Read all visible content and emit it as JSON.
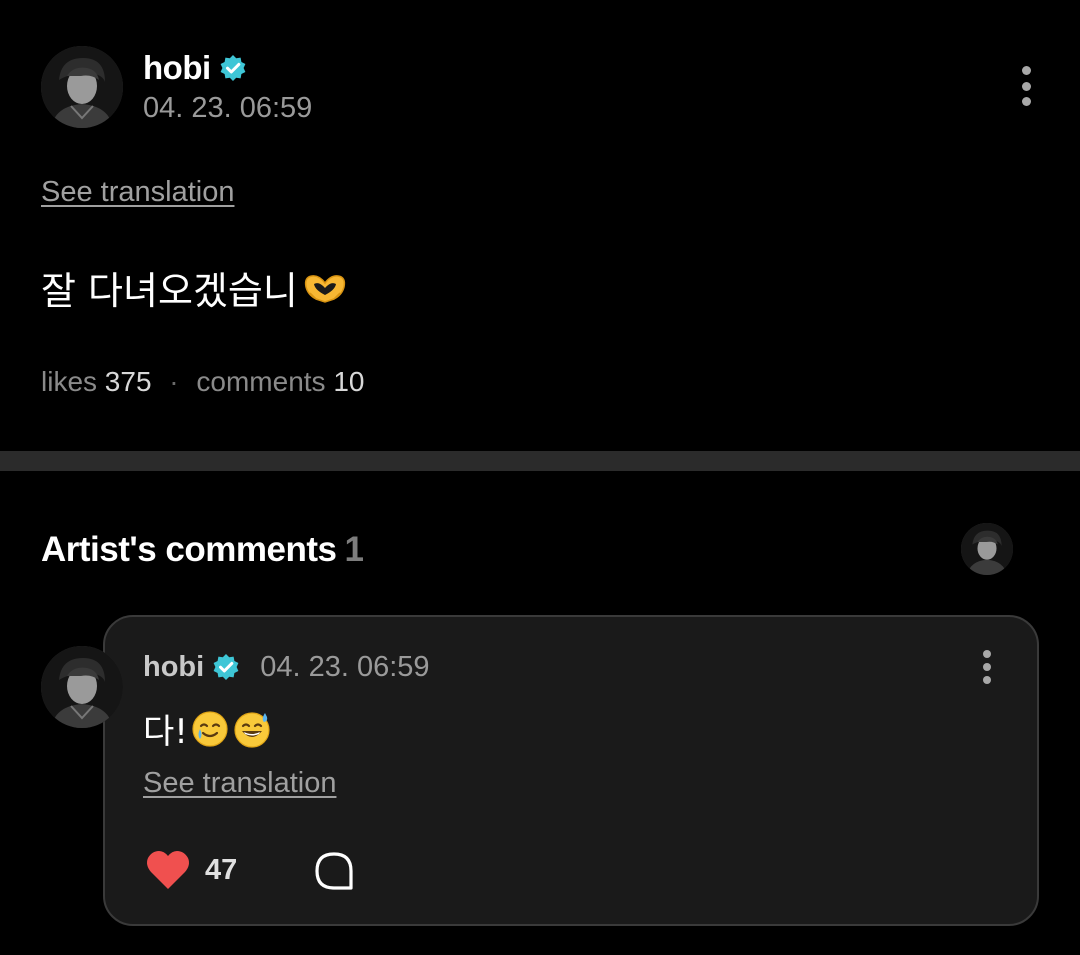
{
  "post": {
    "author": "hobi",
    "timestamp": "04. 23. 06:59",
    "see_translation": "See translation",
    "text": "잘 다녀오겠습니",
    "emoji_icon": "heart-hands-icon",
    "stats": {
      "likes_label": "likes",
      "likes_count": "375",
      "separator": "·",
      "comments_label": "comments",
      "comments_count": "10"
    }
  },
  "artist_comments": {
    "title": "Artist's comments",
    "count": "1"
  },
  "comment": {
    "author": "hobi",
    "timestamp": "04. 23. 06:59",
    "text": "다!",
    "emoji_icons": [
      "smiling-face-with-tear-icon",
      "grinning-face-with-sweat-icon"
    ],
    "see_translation": "See translation",
    "like_count": "47"
  },
  "colors": {
    "background": "#000000",
    "verified_badge": "#3ec6d6",
    "heart": "#f0504f",
    "card_background": "#1a1a1a"
  }
}
